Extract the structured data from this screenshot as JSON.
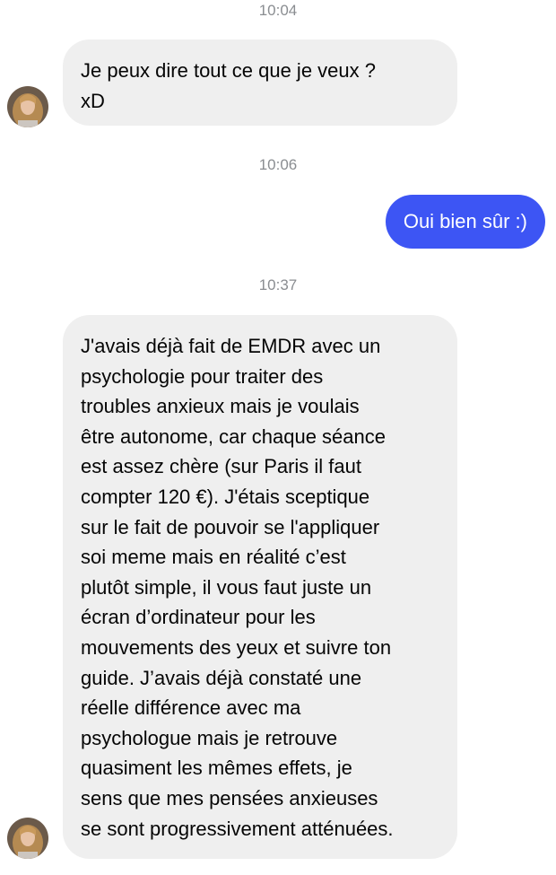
{
  "messages": [
    {
      "timestamp": "10:04",
      "direction": "incoming",
      "avatar_icon": "contact-avatar-icon",
      "text": "Je peux dire tout ce que je veux ?\nxD"
    },
    {
      "timestamp": "10:06",
      "direction": "outgoing",
      "text": "Oui bien sûr :)"
    },
    {
      "timestamp": "10:37",
      "direction": "incoming",
      "avatar_icon": "contact-avatar-icon",
      "text": "J'avais déjà fait de EMDR avec un\npsychologie pour traiter des\ntroubles anxieux mais je voulais\nêtre autonome, car chaque séance\nest assez chère (sur Paris il faut\ncompter 120 €). J'étais sceptique\nsur le fait de pouvoir se l'appliquer\nsoi meme mais en réalité c’est\nplutôt simple, il vous faut juste un\nécran d’ordinateur pour les\nmouvements des yeux et suivre ton\nguide. J’avais déjà constaté une\nréelle différence avec ma\npsychologue mais je retrouve\nquasiment les mêmes effets, je\nsens que mes pensées anxieuses\nse sont progressivement atténuées."
    }
  ],
  "colors": {
    "incoming_bubble": "#efefef",
    "outgoing_bubble": "#3d55f4",
    "timestamp_text": "#8a8d91"
  }
}
